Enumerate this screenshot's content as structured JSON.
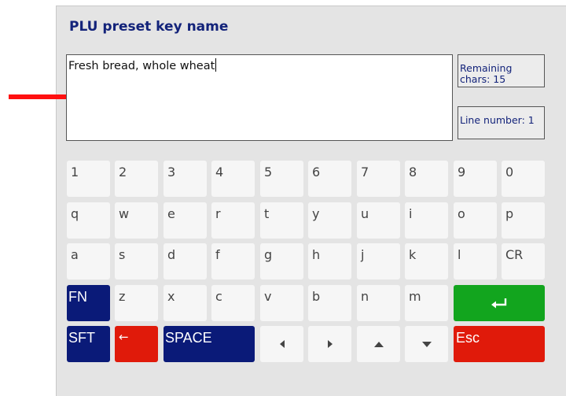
{
  "title": "PLU preset key name",
  "input": {
    "value": "Fresh bread, whole wheat"
  },
  "info": {
    "remaining_label": "Remaining chars: 15",
    "line_label": "Line number: 1"
  },
  "keyboard": {
    "row1": [
      "1",
      "2",
      "3",
      "4",
      "5",
      "6",
      "7",
      "8",
      "9",
      "0"
    ],
    "row2": [
      "q",
      "w",
      "e",
      "r",
      "t",
      "y",
      "u",
      "i",
      "o",
      "p"
    ],
    "row3": [
      "a",
      "s",
      "d",
      "f",
      "g",
      "h",
      "j",
      "k",
      "l",
      "CR"
    ],
    "row4": [
      "FN",
      "z",
      "x",
      "c",
      "v",
      "b",
      "n",
      "m"
    ],
    "row5": {
      "sft": "SFT",
      "backspace": "←",
      "space": "SPACE",
      "esc": "Esc"
    }
  },
  "colors": {
    "title": "#13237a",
    "navy_key": "#0a1a78",
    "red_key": "#e01a0a",
    "green_key": "#12a51e",
    "pointer_arrow": "#ff1010"
  },
  "icons": {
    "enter": "return-arrow-icon",
    "left": "triangle-left-icon",
    "right": "triangle-right-icon",
    "up": "triangle-up-icon",
    "down": "triangle-down-icon",
    "pointer": "red-arrow-pointer"
  }
}
